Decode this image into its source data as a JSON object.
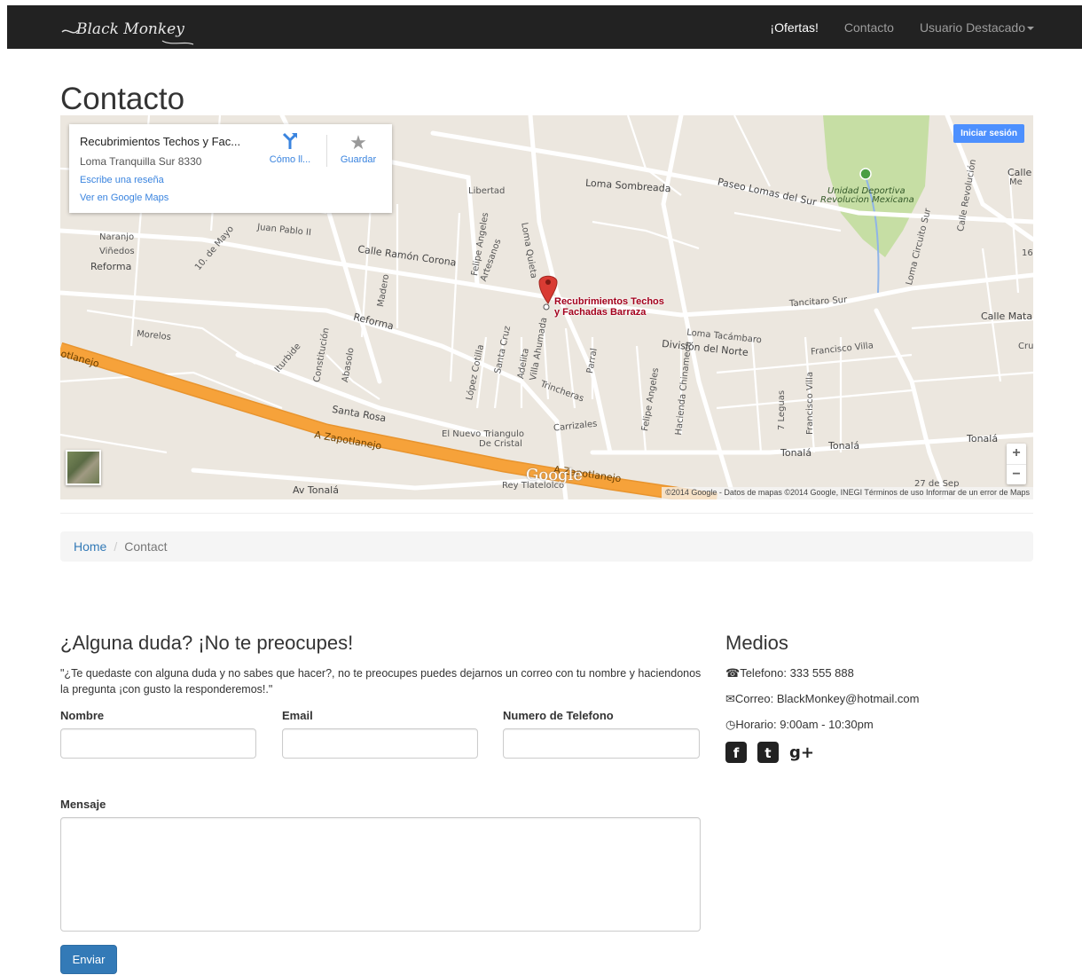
{
  "navbar": {
    "brand": "Black Monkey",
    "items": [
      {
        "label": "¡Ofertas!",
        "active": true
      },
      {
        "label": "Contacto",
        "active": false
      },
      {
        "label": "Usuario Destacado",
        "active": false
      }
    ]
  },
  "page_title": "Contacto",
  "map": {
    "place_title": "Recubrimientos Techos y Fac...",
    "place_address": "Loma Tranquilla Sur 8330",
    "review_link": "Escribe una reseña",
    "maps_link": "Ver en Google Maps",
    "directions_label": "Cómo ll...",
    "save_label": "Guardar",
    "login_label": "Iniciar sesión",
    "pin_label_1": "Recubrimientos Techos",
    "pin_label_2": "y Fachadas Barraza",
    "google_logo": "Google",
    "attribution": "©2014 Google - Datos de mapas ©2014 Google, INEGI   Términos de uso   Informar de un error de Maps",
    "zoom_in": "+",
    "zoom_out": "−",
    "street_labels": {
      "libertad": "Libertad",
      "loma_sombreada": "Loma Sombreada",
      "paseo_lomas": "Paseo Lomas del Sur",
      "unidad_1": "Unidad Deportiva",
      "unidad_2": "Revolucion Mexicana",
      "naranjo": "Naranjo",
      "vinedos": "Viñedos",
      "reforma_1": "Reforma",
      "juan_pablo": "Juan Pablo II",
      "ramon_corona": "Calle Ramón Corona",
      "reforma_2": "Reforma",
      "morelos": "Morelos",
      "tancitaro": "Tancitaro Sur",
      "calle_mata": "Calle Mata",
      "loma_tacambaro": "Loma Tacámbaro",
      "division_norte": "División del Norte",
      "francisco_villa": "Francisco Villa",
      "santa_rosa": "Santa Rosa",
      "zapotlanejo_1": "A Zapotlanejo",
      "zapotlanejo_2": "A Zapotlanejo",
      "zapotlanejo_3": "otlanejo",
      "nuevo_triangulo_1": "El Nuevo Triangulo",
      "nuevo_triangulo_2": "De Cristal",
      "carrizales": "Carrizales",
      "trincheras": "Trincheras",
      "tonala_1": "Tonalá",
      "tonala_2": "Tonalá",
      "tonala_3": "Tonalá",
      "av_tonala": "Av Tonalá",
      "rey_tlatelolco": "Rey Tlatelolco",
      "dia_27": "27 de Sep",
      "calle": "Calle",
      "calle_revolucion": "Calle Revolución",
      "felipe_angeles": "Felipe Angeles",
      "artesanos": "Artesanos",
      "madero": "Madero",
      "constitucion": "Constitución",
      "abasolo": "Abasolo",
      "iturbide": "Iturbide",
      "lopez_cotilla": "López Cotilla",
      "santa_cruz": "Santa Cruz",
      "adelita": "Adelita",
      "villa_ahumada": "Villa Ahumada",
      "parral": "Parral",
      "hacienda": "Hacienda Chinameca",
      "felipe_angeles_2": "Felipe Angeles",
      "siete_leguas": "7 Leguas",
      "francisco_villa_v": "Francisco Villa",
      "loma_circuito": "Loma Circuito Sur",
      "loma_quieta": "Loma Quieta",
      "mayo": "10. de Mayo",
      "cru": "Cru",
      "me": "Me",
      "n16": "16"
    }
  },
  "breadcrumb": {
    "home": "Home",
    "divider": "/",
    "current": "Contact"
  },
  "contact": {
    "heading": "¿Alguna duda? ¡No te preocupes!",
    "intro": "\"¿Te quedaste con alguna duda y no sabes que hacer?, no te preocupes puedes dejarnos un correo con tu nombre y haciendonos la pregunta ¡con gusto la responderemos!.\"",
    "name_label": "Nombre",
    "email_label": "Email",
    "phone_label": "Numero de Telefono",
    "message_label": "Mensaje",
    "send_label": "Enviar"
  },
  "media": {
    "heading": "Medios",
    "phone": "Telefono: 333 555 888",
    "email": "Correo: BlackMonkey@hotmail.com",
    "hours": "Horario: 9:00am - 10:30pm",
    "social": [
      "facebook-icon",
      "twitter-icon",
      "google-plus-icon"
    ]
  },
  "colors": {
    "navbar_bg": "#222222",
    "primary": "#337ab7",
    "map_bg": "#ece7df",
    "highway": "#f6a23a",
    "park": "#c6dea4",
    "pin": "#d93b33"
  }
}
